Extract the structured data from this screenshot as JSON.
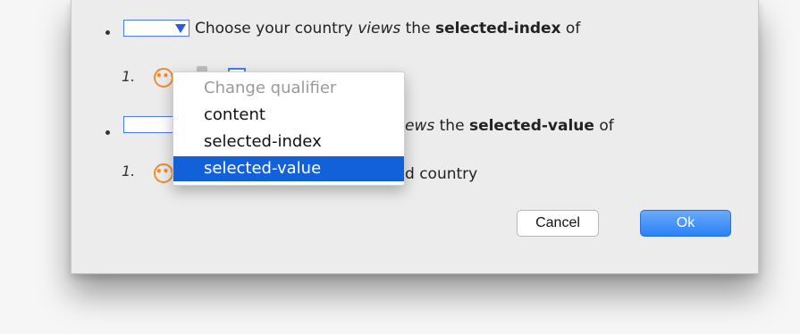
{
  "rows": [
    {
      "prefix": "Choose your country",
      "verb": "views",
      "mid": "the",
      "property": "selected-index",
      "suffix": "of"
    },
    {
      "prefix": "",
      "verb": "views",
      "mid": "the",
      "property": "selected-value",
      "suffix": "of",
      "visible_verb": "ews"
    },
    {
      "number": "1.",
      "text_fragment": "d country"
    }
  ],
  "list_numbers": [
    "1.",
    "1."
  ],
  "menu": {
    "header": "Change qualifier",
    "items": [
      "content",
      "selected-index",
      "selected-value"
    ],
    "selected": "selected-value"
  },
  "buttons": {
    "cancel": "Cancel",
    "ok": "Ok"
  },
  "colors": {
    "accent_blue": "#1261d8",
    "orange": "#f08c2a",
    "select_border": "#4a7cf0"
  }
}
